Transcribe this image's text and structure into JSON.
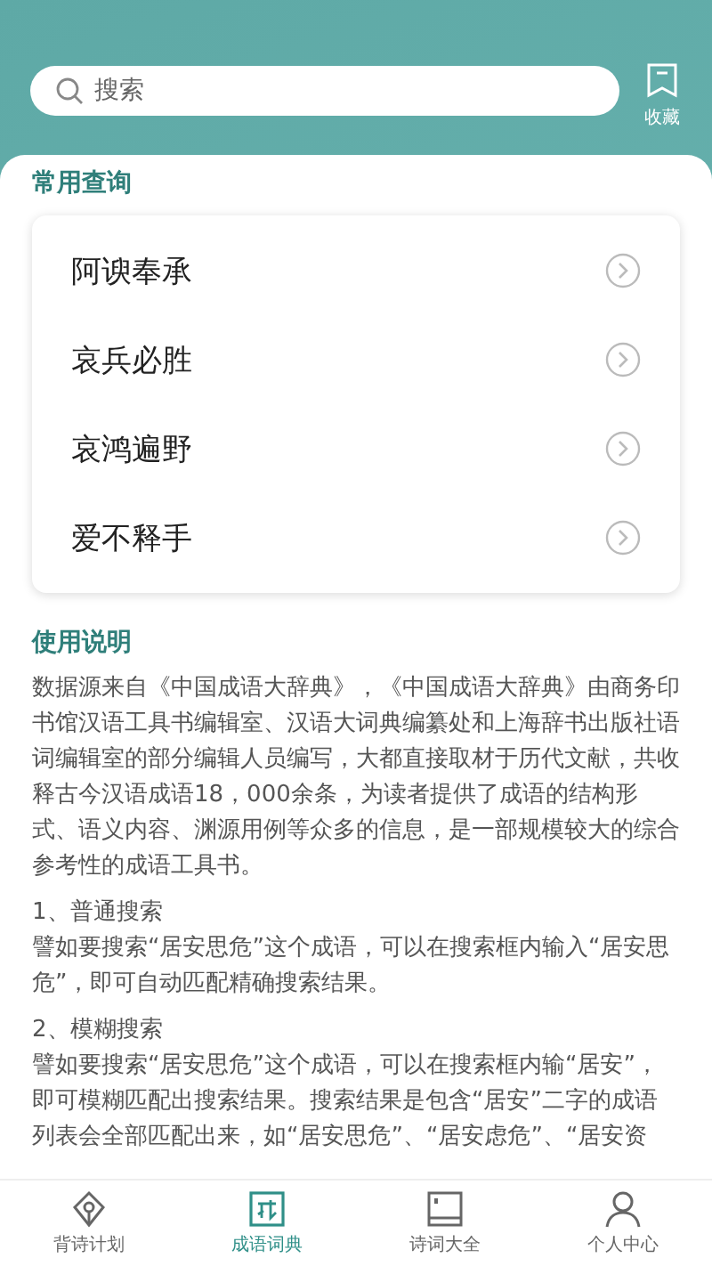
{
  "search": {
    "placeholder": "搜索"
  },
  "favorites": {
    "label": "收藏"
  },
  "common": {
    "title": "常用查询",
    "items": [
      {
        "label": "阿谀奉承"
      },
      {
        "label": "哀兵必胜"
      },
      {
        "label": "哀鸿遍野"
      },
      {
        "label": "爱不释手"
      }
    ]
  },
  "usage": {
    "title": "使用说明",
    "blocks": [
      {
        "text": "数据源来自《中国成语大辞典》，《中国成语大辞典》由商务印书馆汉语工具书编辑室、汉语大词典编纂处和上海辞书出版社语词编辑室的部分编辑人员编写，大都直接取材于历代文献，共收释古今汉语成语18，000余条，为读者提供了成语的结构形式、语义内容、渊源用例等众多的信息，是一部规模较大的综合参考性的成语工具书。"
      },
      {
        "heading": "1、普通搜索",
        "text": "譬如要搜索“居安思危”这个成语，可以在搜索框内输入“居安思危”，即可自动匹配精确搜索结果。"
      },
      {
        "heading": "2、模糊搜索",
        "text": "譬如要搜索“居安思危”这个成语，可以在搜索框内输“居安”，即可模糊匹配出搜索结果。搜索结果是包含“居安”二字的成语列表会全部匹配出来，如“居安思危”、“居安虑危”、“居安资"
      }
    ]
  },
  "tabs": [
    {
      "label": "背诗计划",
      "kind": "pen",
      "selected": false
    },
    {
      "label": "成语词典",
      "kind": "idiom",
      "selected": true
    },
    {
      "label": "诗词大全",
      "kind": "book",
      "selected": false
    },
    {
      "label": "个人中心",
      "kind": "person",
      "selected": false
    }
  ]
}
